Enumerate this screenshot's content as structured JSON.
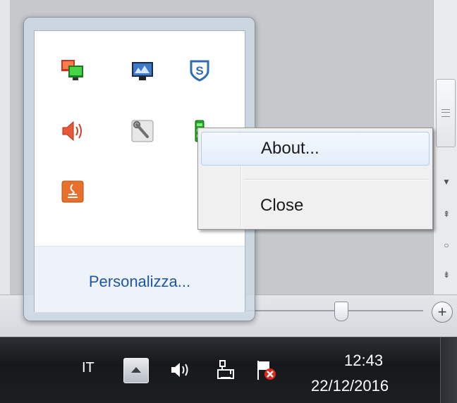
{
  "flyout": {
    "customize_link": "Personalizza...",
    "icons": [
      "network-connections-icon",
      "network-monitor-icon",
      "security-shield-s-icon",
      "volume-speaker-icon",
      "wrench-tool-icon",
      "green-battery-app-icon",
      "orange-java-app-icon"
    ]
  },
  "context_menu": {
    "items": [
      {
        "label": "About..."
      },
      {
        "label": "Close"
      }
    ]
  },
  "taskbar": {
    "language": "IT",
    "clock": {
      "time": "12:43",
      "date": "22/12/2016"
    }
  },
  "colors": {
    "link": "#1e57a3",
    "taskbar": "#1c1f22",
    "menu_highlight": "#e3eefa"
  }
}
